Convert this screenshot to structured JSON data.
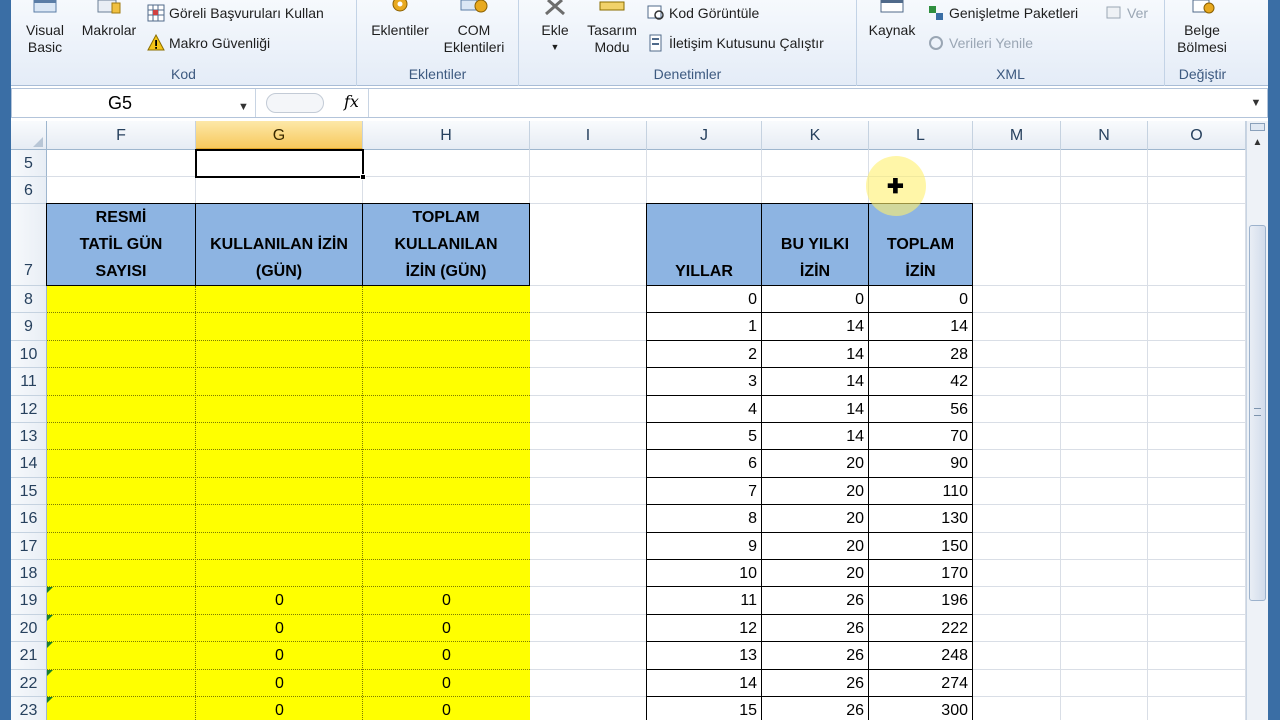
{
  "ribbon": {
    "groups": [
      {
        "label": "Kod",
        "big_buttons": [
          "Visual Basic",
          "Makrolar"
        ],
        "small_buttons": [
          "Göreli Başvuruları Kullan",
          "Makro Güvenliği"
        ]
      },
      {
        "label": "Eklentiler",
        "big_buttons": [
          "Eklentiler",
          "COM Eklentileri"
        ]
      },
      {
        "label": "Denetimler",
        "big_buttons": [
          "Ekle",
          "Tasarım Modu"
        ],
        "small_buttons": [
          "Kod Görüntüle",
          "İletişim Kutusunu Çalıştır"
        ]
      },
      {
        "label": "XML",
        "big_buttons": [
          "Kaynak"
        ],
        "small_buttons": [
          "Genişletme Paketleri",
          "Verileri Yenile",
          "Ver"
        ]
      },
      {
        "label": "Değiştir",
        "big_buttons": [
          "Belge Bölmesi"
        ]
      }
    ],
    "labels": {
      "visual_basic_1": "Visual",
      "visual_basic_2": "Basic",
      "makrolar": "Makrolar",
      "goreli": "Göreli Başvuruları Kullan",
      "makro_guvenligi": "Makro Güvenliği",
      "kod": "Kod",
      "eklentiler": "Eklentiler",
      "com_1": "COM",
      "com_2": "Eklentileri",
      "eklentiler_group": "Eklentiler",
      "ekle": "Ekle",
      "tasarim_1": "Tasarım",
      "tasarim_2": "Modu",
      "kod_goruntule": "Kod Görüntüle",
      "iletisim": "İletişim Kutusunu Çalıştır",
      "denetimler": "Denetimler",
      "kaynak": "Kaynak",
      "genisletme": "Genişletme Paketleri",
      "verileri_yenile": "Verileri Yenile",
      "ver": "Ver",
      "xml": "XML",
      "belge_1": "Belge",
      "belge_2": "Bölmesi",
      "degistir": "Değiştir"
    }
  },
  "formula_bar": {
    "name_box": "G5",
    "fx": "fx",
    "formula": ""
  },
  "sheet": {
    "columns": [
      "F",
      "G",
      "H",
      "I",
      "J",
      "K",
      "L",
      "M",
      "N",
      "O"
    ],
    "selected_column": "G",
    "rows": [
      "5",
      "6",
      "7",
      "8",
      "9",
      "10",
      "11",
      "12",
      "13",
      "14",
      "15",
      "16",
      "17",
      "18",
      "19",
      "20",
      "21",
      "22",
      "23"
    ],
    "selected_cell": "G5",
    "left_table": {
      "headers": [
        {
          "l1": "RESMİ",
          "l2": "TATİL GÜN",
          "l3": "SAYISI"
        },
        {
          "l1": "",
          "l2": "KULLANILAN İZİN",
          "l3": "(GÜN)"
        },
        {
          "l1": "TOPLAM",
          "l2": "KULLANILAN",
          "l3": "İZİN (GÜN)"
        }
      ],
      "values_rows_19_23": [
        {
          "G": "0",
          "H": "0"
        },
        {
          "G": "0",
          "H": "0"
        },
        {
          "G": "0",
          "H": "0"
        },
        {
          "G": "0",
          "H": "0"
        },
        {
          "G": "0",
          "H": "0"
        }
      ],
      "fill_color": "#ffff00"
    },
    "right_table": {
      "headers": [
        {
          "l1": "",
          "l2": "",
          "l3": "YILLAR"
        },
        {
          "l1": "",
          "l2": "BU YILKI",
          "l3": "İZİN"
        },
        {
          "l1": "",
          "l2": "TOPLAM",
          "l3": "İZİN"
        }
      ],
      "rows": [
        [
          "0",
          "0",
          "0"
        ],
        [
          "1",
          "14",
          "14"
        ],
        [
          "2",
          "14",
          "28"
        ],
        [
          "3",
          "14",
          "42"
        ],
        [
          "4",
          "14",
          "56"
        ],
        [
          "5",
          "14",
          "70"
        ],
        [
          "6",
          "20",
          "90"
        ],
        [
          "7",
          "20",
          "110"
        ],
        [
          "8",
          "20",
          "130"
        ],
        [
          "9",
          "20",
          "150"
        ],
        [
          "10",
          "20",
          "170"
        ],
        [
          "11",
          "26",
          "196"
        ],
        [
          "12",
          "26",
          "222"
        ],
        [
          "13",
          "26",
          "248"
        ],
        [
          "14",
          "26",
          "274"
        ],
        [
          "15",
          "26",
          "300"
        ]
      ],
      "header_color": "#8db4e2"
    }
  }
}
